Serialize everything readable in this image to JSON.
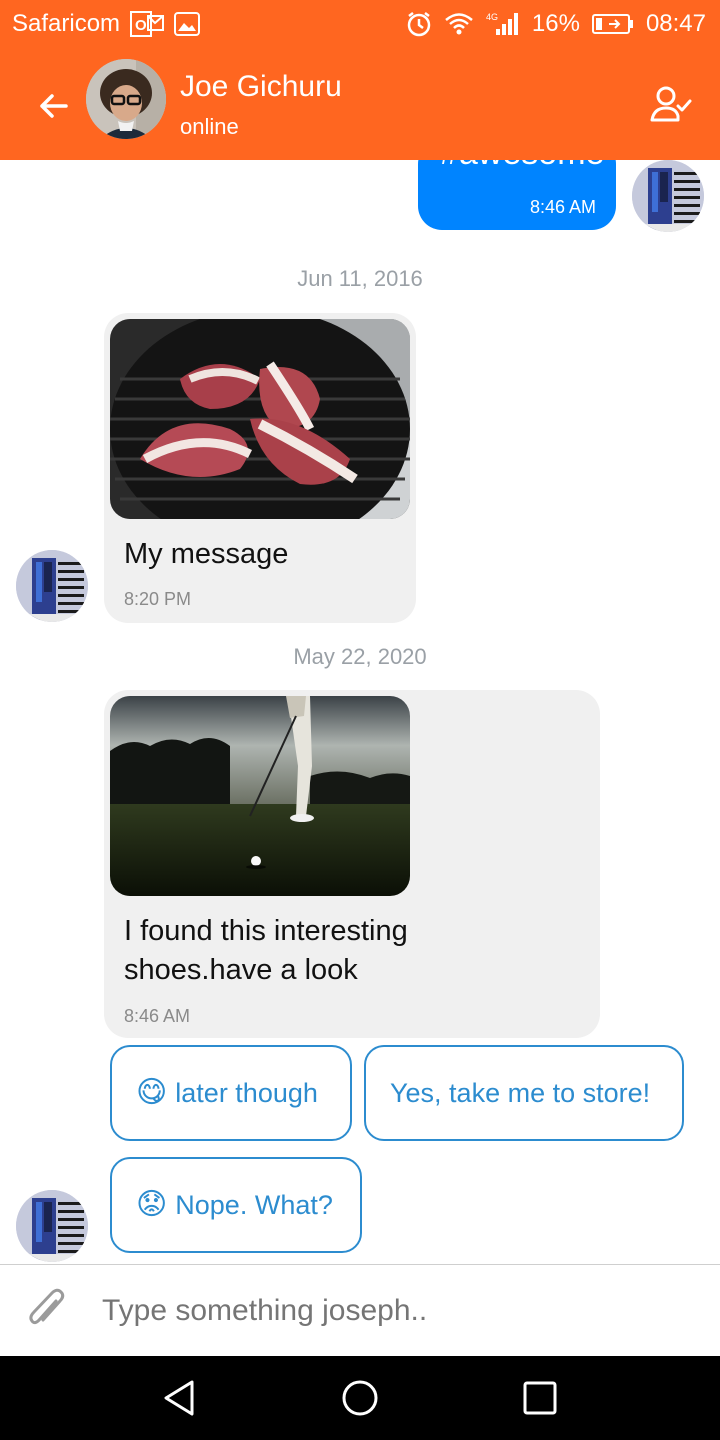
{
  "status_bar": {
    "carrier": "Safaricom",
    "battery": "16%",
    "time": "08:47",
    "signal_label": "4G"
  },
  "header": {
    "name": "Joe Gichuru",
    "status": "online"
  },
  "messages": [
    {
      "type": "outgoing",
      "text": "#awesome",
      "time": "8:46 AM"
    },
    {
      "type": "date",
      "text": "Jun 11, 2016"
    },
    {
      "type": "incoming",
      "image": "grill-meat-photo",
      "text": "My message",
      "time": "8:20 PM"
    },
    {
      "type": "date",
      "text": "May 22, 2020"
    },
    {
      "type": "incoming",
      "image": "golf-night-photo",
      "text": "I found this interesting shoes.have a look",
      "time": "8:46 AM"
    }
  ],
  "quick_replies": [
    {
      "emoji": "😋",
      "text": "later though"
    },
    {
      "emoji": "",
      "text": "Yes, take me to store!"
    },
    {
      "emoji": "😟",
      "text": "Nope. What?"
    }
  ],
  "composer": {
    "placeholder": "Type something joseph.."
  },
  "colors": {
    "primary": "#FF6620",
    "outgoing_bubble": "#0084FF",
    "incoming_bubble": "#F0F0F0",
    "reply_accent": "#2C8CCF"
  }
}
